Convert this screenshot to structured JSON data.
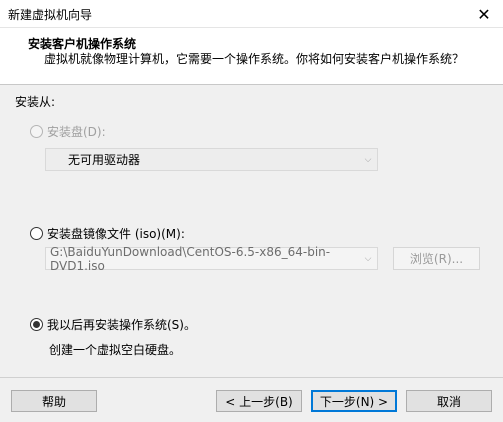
{
  "window": {
    "title": "新建虚拟机向导"
  },
  "header": {
    "title": "安装客户机操作系统",
    "description": "虚拟机就像物理计算机，它需要一个操作系统。你将如何安装客户机操作系统？"
  },
  "install_from": {
    "label": "安装从:"
  },
  "options": {
    "disc": {
      "label": "安装盘(D):",
      "drive_value": "无可用驱动器"
    },
    "iso": {
      "label": "安装盘镜像文件 (iso)(M):",
      "path_value": "G:\\BaiduYunDownload\\CentOS-6.5-x86_64-bin-DVD1.iso",
      "browse_label": "浏览(R)..."
    },
    "later": {
      "label": "我以后再安装操作系统(S)。",
      "note": "创建一个虚拟空白硬盘。"
    }
  },
  "buttons": {
    "help": "帮助",
    "back": "< 上一步(B)",
    "next": "下一步(N) >",
    "cancel": "取消"
  }
}
